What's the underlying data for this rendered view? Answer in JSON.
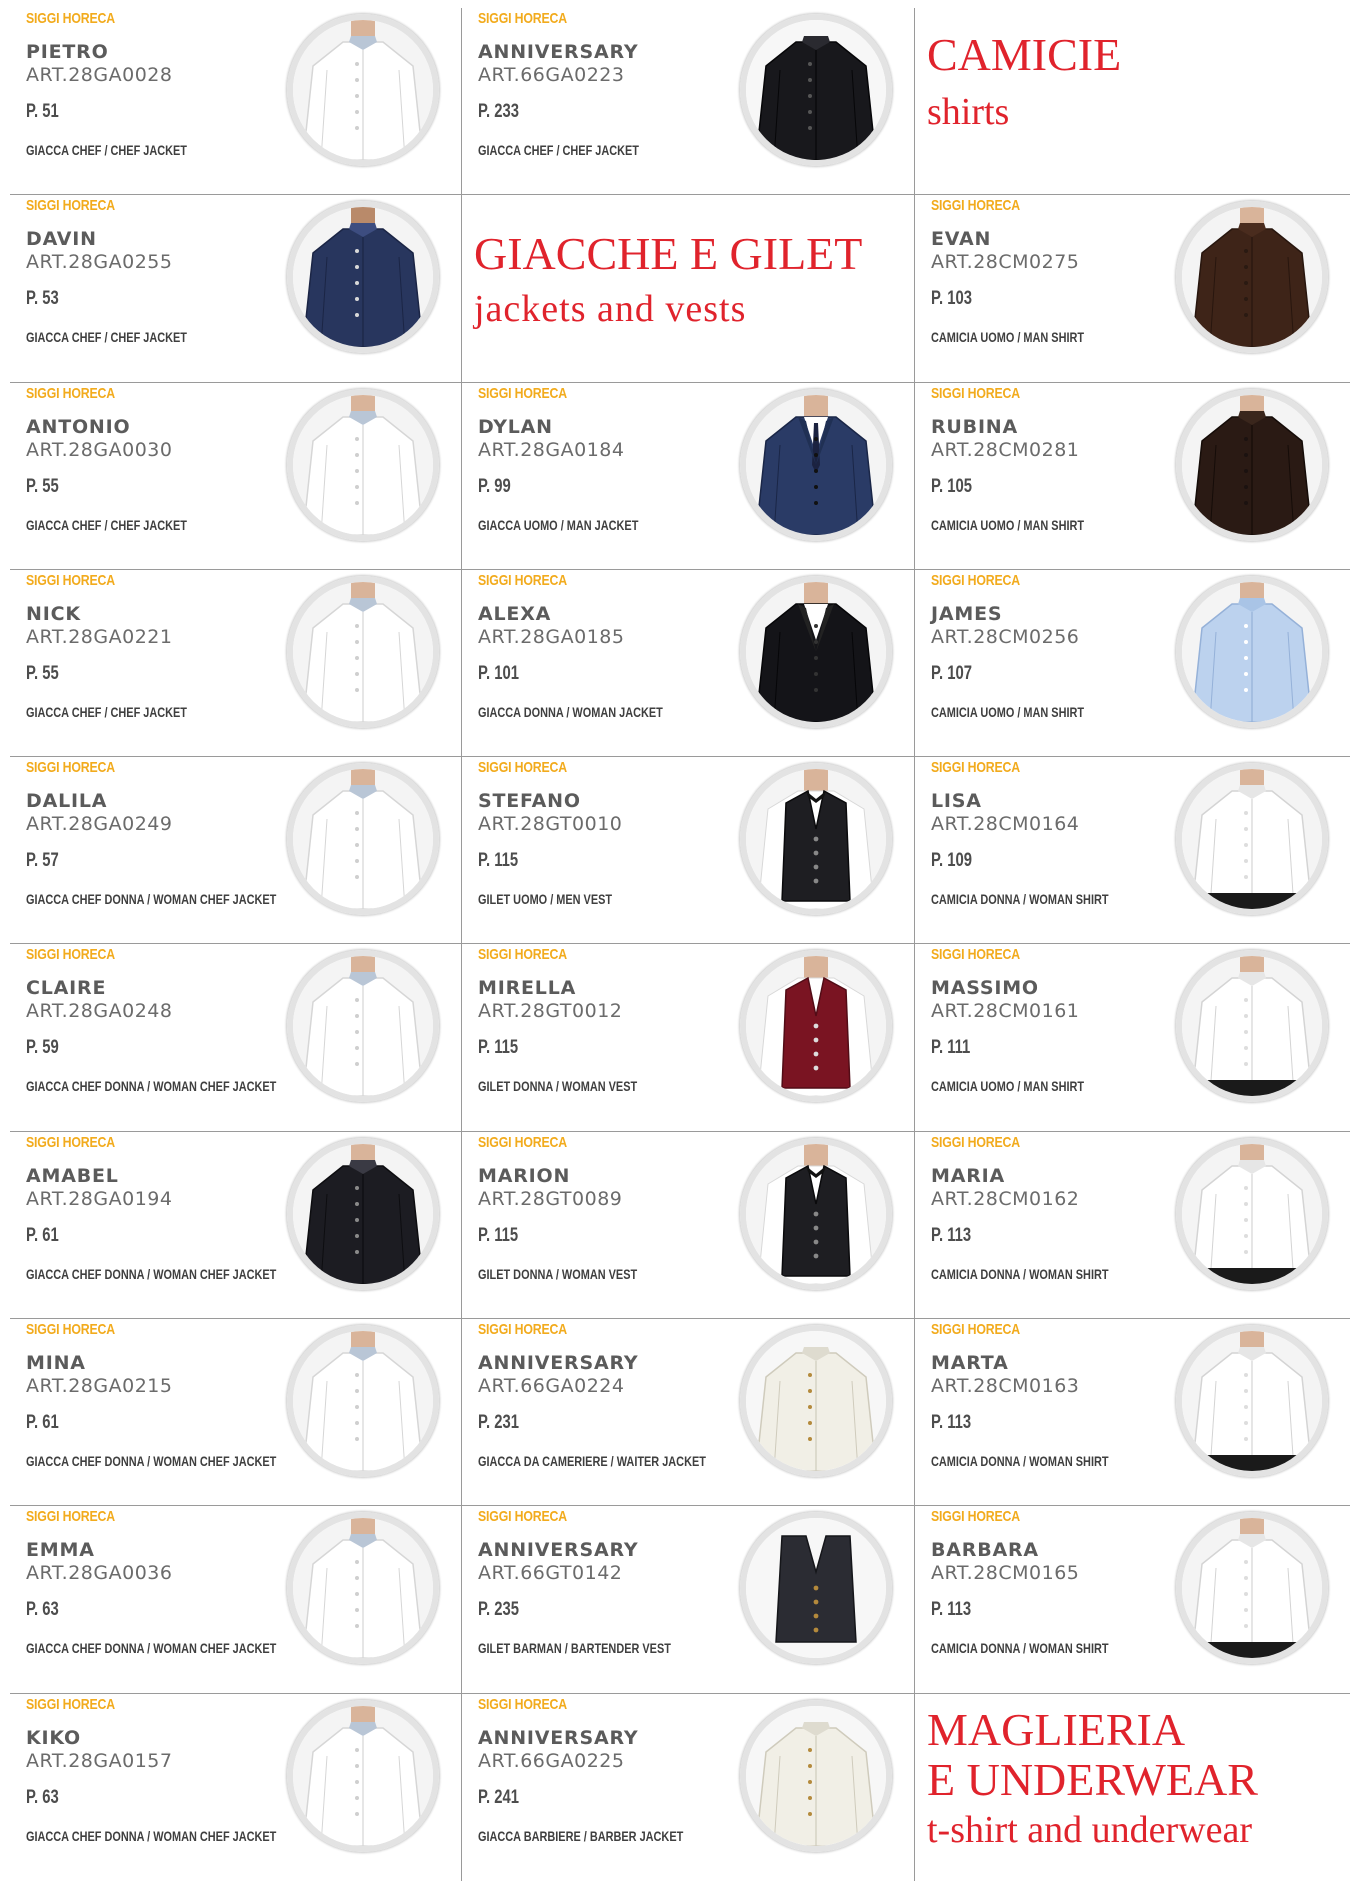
{
  "accent_color": "#e0232c",
  "brand_color": "#f2ab1d",
  "headings": {
    "shirts": {
      "title": "CAMICIE",
      "subtitle": "shirts"
    },
    "jackets": {
      "title": "GIACCHE E GILET",
      "subtitle": "jackets and vests"
    },
    "knitwear": {
      "title_line1": "MAGLIERIA",
      "title_line2": "E UNDERWEAR",
      "subtitle": "t-shirt and underwear"
    }
  },
  "column1": [
    {
      "brand": "SIGGI HORECA",
      "name": "PIETRO",
      "art": "ART.28GA0028",
      "page": "P. 51",
      "category": "GIACCA CHEF / CHEF JACKET",
      "image": "white-chef-jacket"
    },
    {
      "brand": "SIGGI HORECA",
      "name": "DAVIN",
      "art": "ART.28GA0255",
      "page": "P. 53",
      "category": "GIACCA CHEF / CHEF JACKET",
      "image": "navy-chef-jacket"
    },
    {
      "brand": "SIGGI HORECA",
      "name": "ANTONIO",
      "art": "ART.28GA0030",
      "page": "P. 55",
      "category": "GIACCA CHEF / CHEF JACKET",
      "image": "white-chef-jacket"
    },
    {
      "brand": "SIGGI HORECA",
      "name": "NICK",
      "art": "ART.28GA0221",
      "page": "P. 55",
      "category": "GIACCA CHEF / CHEF JACKET",
      "image": "white-chef-jacket"
    },
    {
      "brand": "SIGGI HORECA",
      "name": "DALILA",
      "art": "ART.28GA0249",
      "page": "P. 57",
      "category": "GIACCA CHEF DONNA / WOMAN CHEF JACKET",
      "image": "white-chef-jacket"
    },
    {
      "brand": "SIGGI HORECA",
      "name": "CLAIRE",
      "art": "ART.28GA0248",
      "page": "P. 59",
      "category": "GIACCA CHEF DONNA / WOMAN CHEF JACKET",
      "image": "white-chef-jacket"
    },
    {
      "brand": "SIGGI HORECA",
      "name": "AMABEL",
      "art": "ART.28GA0194",
      "page": "P. 61",
      "category": "GIACCA CHEF DONNA / WOMAN CHEF JACKET",
      "image": "black-chef-jacket"
    },
    {
      "brand": "SIGGI HORECA",
      "name": "MINA",
      "art": "ART.28GA0215",
      "page": "P. 61",
      "category": "GIACCA CHEF DONNA / WOMAN CHEF JACKET",
      "image": "white-chef-jacket"
    },
    {
      "brand": "SIGGI HORECA",
      "name": "EMMA",
      "art": "ART.28GA0036",
      "page": "P. 63",
      "category": "GIACCA CHEF DONNA / WOMAN CHEF JACKET",
      "image": "white-chef-jacket"
    },
    {
      "brand": "SIGGI HORECA",
      "name": "KIKO",
      "art": "ART.28GA0157",
      "page": "P. 63",
      "category": "GIACCA CHEF DONNA / WOMAN CHEF JACKET",
      "image": "white-chef-jacket"
    }
  ],
  "column2": [
    {
      "brand": "SIGGI HORECA",
      "name": "ANNIVERSARY",
      "art": "ART.66GA0223",
      "page": "P. 233",
      "category": "GIACCA CHEF / CHEF JACKET",
      "image": "black-jacket-flat"
    },
    null,
    {
      "brand": "SIGGI HORECA",
      "name": "DYLAN",
      "art": "ART.28GA0184",
      "page": "P. 99",
      "category": "GIACCA UOMO / MAN JACKET",
      "image": "navy-suit"
    },
    {
      "brand": "SIGGI HORECA",
      "name": "ALEXA",
      "art": "ART.28GA0185",
      "page": "P. 101",
      "category": "GIACCA DONNA / WOMAN JACKET",
      "image": "black-suit"
    },
    {
      "brand": "SIGGI HORECA",
      "name": "STEFANO",
      "art": "ART.28GT0010",
      "page": "P. 115",
      "category": "GILET UOMO / MEN VEST",
      "image": "black-vest"
    },
    {
      "brand": "SIGGI HORECA",
      "name": "MIRELLA",
      "art": "ART.28GT0012",
      "page": "P. 115",
      "category": "GILET DONNA / WOMAN VEST",
      "image": "red-vest"
    },
    {
      "brand": "SIGGI HORECA",
      "name": "MARION",
      "art": "ART.28GT0089",
      "page": "P. 115",
      "category": "GILET DONNA / WOMAN VEST",
      "image": "black-vest"
    },
    {
      "brand": "SIGGI HORECA",
      "name": "ANNIVERSARY",
      "art": "ART.66GA0224",
      "page": "P. 231",
      "category": "GIACCA DA CAMERIERE / WAITER JACKET",
      "image": "white-jacket-flat"
    },
    {
      "brand": "SIGGI HORECA",
      "name": "ANNIVERSARY",
      "art": "ART.66GT0142",
      "page": "P. 235",
      "category": "GILET BARMAN / BARTENDER VEST",
      "image": "dark-vest-flat"
    },
    {
      "brand": "SIGGI HORECA",
      "name": "ANNIVERSARY",
      "art": "ART.66GA0225",
      "page": "P. 241",
      "category": "GIACCA BARBIERE / BARBER JACKET",
      "image": "white-jacket-flat"
    }
  ],
  "column3": [
    null,
    {
      "brand": "SIGGI HORECA",
      "name": "EVAN",
      "art": "ART.28CM0275",
      "page": "P. 103",
      "category": "CAMICIA UOMO / MAN SHIRT",
      "image": "brown-shirt"
    },
    {
      "brand": "SIGGI HORECA",
      "name": "RUBINA",
      "art": "ART.28CM0281",
      "page": "P. 105",
      "category": "CAMICIA UOMO / MAN SHIRT",
      "image": "dark-brown-shirt"
    },
    {
      "brand": "SIGGI HORECA",
      "name": "JAMES",
      "art": "ART.28CM0256",
      "page": "P. 107",
      "category": "CAMICIA UOMO / MAN SHIRT",
      "image": "light-blue-shirt"
    },
    {
      "brand": "SIGGI HORECA",
      "name": "LISA",
      "art": "ART.28CM0164",
      "page": "P. 109",
      "category": "CAMICIA DONNA / WOMAN SHIRT",
      "image": "white-shirt"
    },
    {
      "brand": "SIGGI HORECA",
      "name": "MASSIMO",
      "art": "ART.28CM0161",
      "page": "P. 111",
      "category": "CAMICIA UOMO / MAN SHIRT",
      "image": "white-shirt"
    },
    {
      "brand": "SIGGI HORECA",
      "name": "MARIA",
      "art": "ART.28CM0162",
      "page": "P. 113",
      "category": "CAMICIA DONNA / WOMAN SHIRT",
      "image": "white-shirt"
    },
    {
      "brand": "SIGGI HORECA",
      "name": "MARTA",
      "art": "ART.28CM0163",
      "page": "P. 113",
      "category": "CAMICIA DONNA / WOMAN SHIRT",
      "image": "white-shirt"
    },
    {
      "brand": "SIGGI HORECA",
      "name": "BARBARA",
      "art": "ART.28CM0165",
      "page": "P. 113",
      "category": "CAMICIA DONNA / WOMAN SHIRT",
      "image": "white-shirt"
    },
    null
  ]
}
